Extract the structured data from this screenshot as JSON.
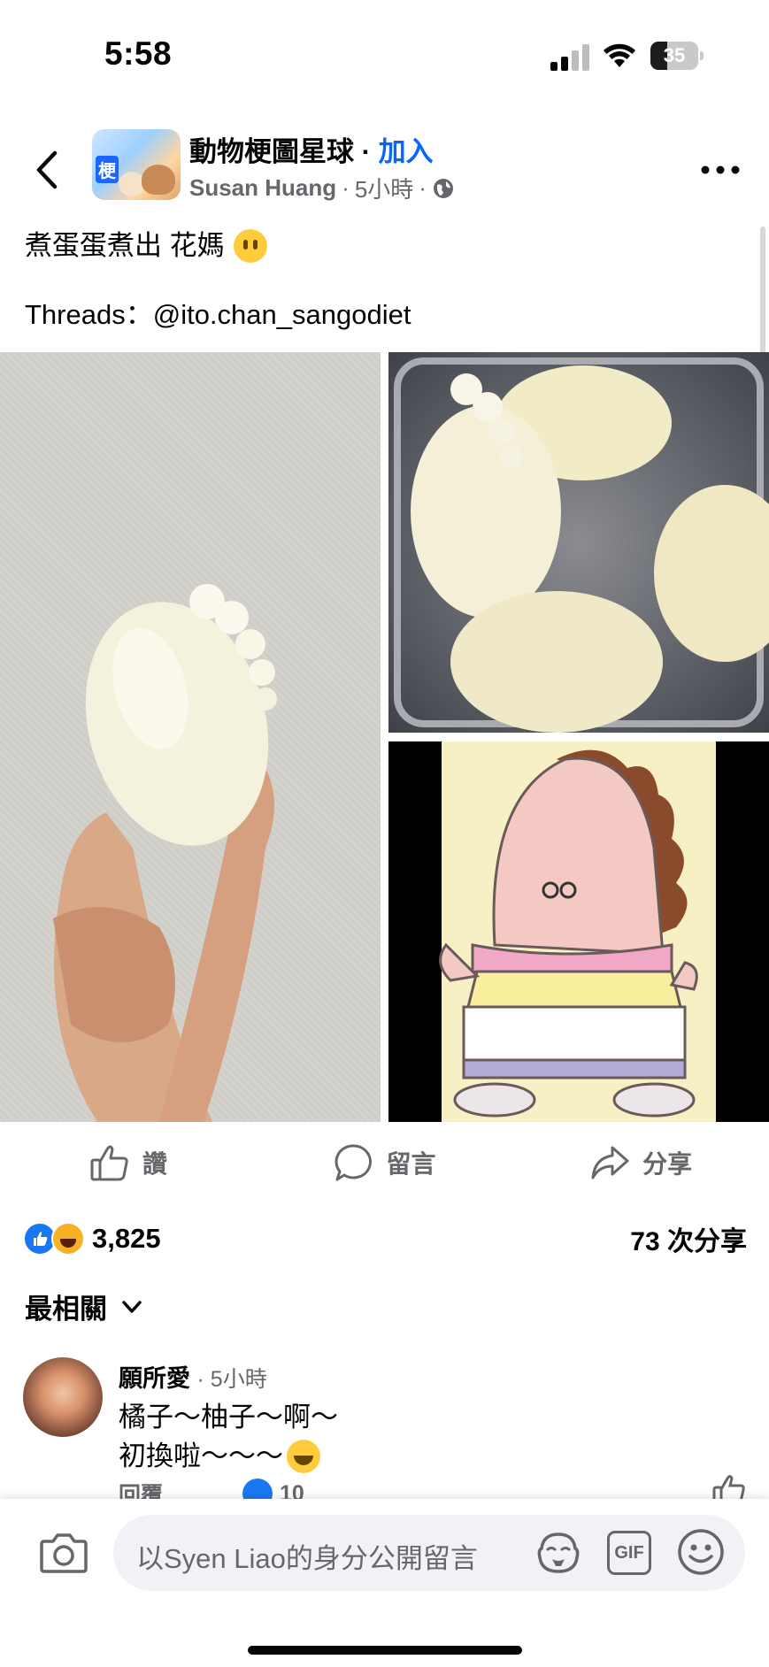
{
  "status_bar": {
    "time": "5:58",
    "battery_percent": 35,
    "icons": [
      "cellular-signal-icon",
      "wifi-icon",
      "battery-icon"
    ]
  },
  "header": {
    "group_name": "動物梗圖星球",
    "separator": " · ",
    "join_label": "加入",
    "author": "Susan Huang",
    "time_ago": "5小時",
    "avatar_tag": "梗",
    "privacy_icon": "globe-icon",
    "back_icon": "chevron-left-icon",
    "more_icon": "more-horizontal-icon"
  },
  "post": {
    "text_line1": "煮蛋蛋煮出 花媽",
    "text_line2": "Threads：@ito.chan_sangodiet"
  },
  "actions": {
    "like": "讚",
    "comment": "留言",
    "share": "分享"
  },
  "stats": {
    "reaction_count": "3,825",
    "share_count": "73 次分享"
  },
  "comments": {
    "sort_label": "最相關",
    "items": [
      {
        "name": "願所愛",
        "time": "5小時",
        "line1": "橘子～柚子～啊～",
        "line2": "初換啦～～～",
        "reply_label": "回覆",
        "like_count": "10"
      }
    ]
  },
  "composer": {
    "placeholder": "以Syen  Liao的身分公開留言"
  },
  "colors": {
    "accent": "#0866ff",
    "secondary_text": "#65676b",
    "like_blue": "#1a77f2",
    "input_bg": "#f0f2f5"
  }
}
